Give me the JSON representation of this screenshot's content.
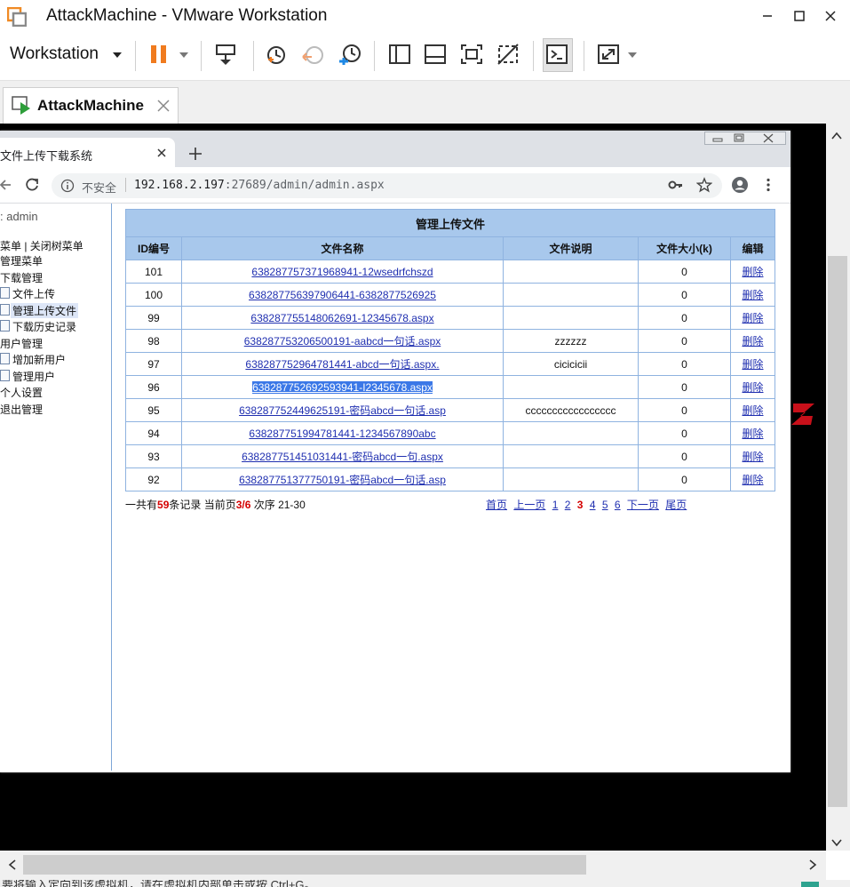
{
  "vmware": {
    "window_title": "AttackMachine - VMware Workstation",
    "menu_label": "Workstation",
    "tab_label": "AttackMachine",
    "status_text": "要将输入定向到该虚拟机，请在虚拟机内部单击或按 Ctrl+G。"
  },
  "browser": {
    "tab_title": "文件上传下载系统",
    "security_label": "不安全",
    "url_host": "192.168.2.197",
    "url_rest": ":27689/admin/admin.aspx"
  },
  "sidebar": {
    "user": ": admin",
    "menu_toggle": "菜单 | 关闭树菜单",
    "items": [
      "管理菜单",
      "下载管理",
      "文件上传",
      "管理上传文件",
      "下载历史记录",
      "用户管理",
      "增加新用户",
      "管理用户",
      "个人设置",
      "退出管理"
    ]
  },
  "table": {
    "caption": "管理上传文件",
    "headers": [
      "ID编号",
      "文件名称",
      "文件说明",
      "文件大小(k)",
      "编辑"
    ],
    "rows": [
      {
        "id": "101",
        "name": "638287757371968941-12wsedrfchszd",
        "desc": "",
        "size": "0",
        "action": "删除"
      },
      {
        "id": "100",
        "name": "638287756397906441-6382877526925",
        "desc": "",
        "size": "0",
        "action": "删除"
      },
      {
        "id": "99",
        "name": "638287755148062691-12345678.aspx",
        "desc": "",
        "size": "0",
        "action": "删除"
      },
      {
        "id": "98",
        "name": "638287753206500191-aabcd一句话.aspx",
        "desc": "zzzzzz",
        "size": "0",
        "action": "删除"
      },
      {
        "id": "97",
        "name": "638287752964781441-abcd一句话.aspx.",
        "desc": "cicicicii",
        "size": "0",
        "action": "删除"
      },
      {
        "id": "96",
        "name": "638287752692593941-I2345678.aspx",
        "desc": "",
        "size": "0",
        "action": "删除"
      },
      {
        "id": "95",
        "name": "638287752449625191-密码abcd一句话.asp",
        "desc": "ccccccccccccccccc",
        "size": "0",
        "action": "删除"
      },
      {
        "id": "94",
        "name": "638287751994781441-1234567890abc",
        "desc": "",
        "size": "0",
        "action": "删除"
      },
      {
        "id": "93",
        "name": "638287751451031441-密码abcd一句.aspx",
        "desc": "",
        "size": "0",
        "action": "删除"
      },
      {
        "id": "92",
        "name": "638287751377750191-密码abcd一句话.asp",
        "desc": "",
        "size": "0",
        "action": "删除"
      }
    ]
  },
  "summary": {
    "prefix": "一共有",
    "total": "59",
    "middle": "条记录 当前页",
    "page": "3/6",
    "suffix": " 次序 21-30"
  },
  "pager": {
    "first": "首页",
    "prev": "上一页",
    "pages": [
      "1",
      "2",
      "3",
      "4",
      "5",
      "6"
    ],
    "current": "3",
    "next": "下一页",
    "last": "尾页"
  },
  "colors": {
    "header_bg": "#a8c8ec",
    "link": "#1f2fb0",
    "highlight": "#d40000",
    "pause_orange": "#f07b1f"
  }
}
